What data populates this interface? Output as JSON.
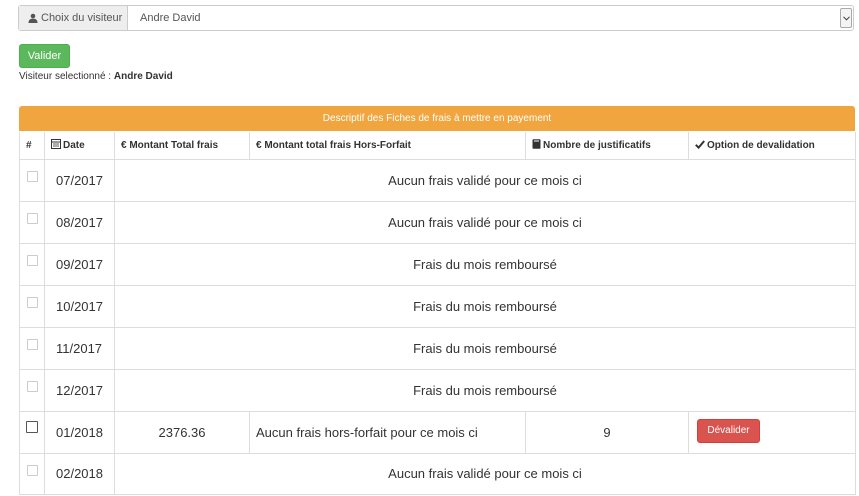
{
  "visitor_select": {
    "label": "Choix du visiteur",
    "value": "Andre David"
  },
  "validate_button": "Valider",
  "selected_visitor": {
    "label": "Visiteur selectionné : ",
    "name": "Andre David"
  },
  "panel_title": "Descriptif des Fiches de frais à mettre en payement",
  "columns": {
    "num": "#",
    "date": "Date",
    "total": "€ Montant Total frais",
    "hors_forfait": "€ Montant total frais Hors-Forfait",
    "justificatifs": "Nombre de justificatifs",
    "option": "Option de devalidation"
  },
  "rows": [
    {
      "date": "07/2017",
      "message": "Aucun frais validé pour ce mois ci"
    },
    {
      "date": "08/2017",
      "message": "Aucun frais validé pour ce mois ci"
    },
    {
      "date": "09/2017",
      "message": "Frais du mois remboursé"
    },
    {
      "date": "10/2017",
      "message": "Frais du mois remboursé"
    },
    {
      "date": "11/2017",
      "message": "Frais du mois remboursé"
    },
    {
      "date": "12/2017",
      "message": "Frais du mois remboursé"
    },
    {
      "date": "01/2018",
      "total": "2376.36",
      "hors_forfait": "Aucun frais hors-forfait pour ce mois ci",
      "justificatifs": "9",
      "action": "Dévalider"
    },
    {
      "date": "02/2018",
      "message": "Aucun frais validé pour ce mois ci"
    }
  ],
  "colors": {
    "success": "#5cb85c",
    "warning": "#f0a53e",
    "danger": "#d9534f"
  },
  "icons": {
    "user": "user-icon",
    "date": "calendar-icon",
    "justificatifs": "book-icon",
    "option": "check-icon",
    "dropdown": "chevron-down-icon"
  }
}
